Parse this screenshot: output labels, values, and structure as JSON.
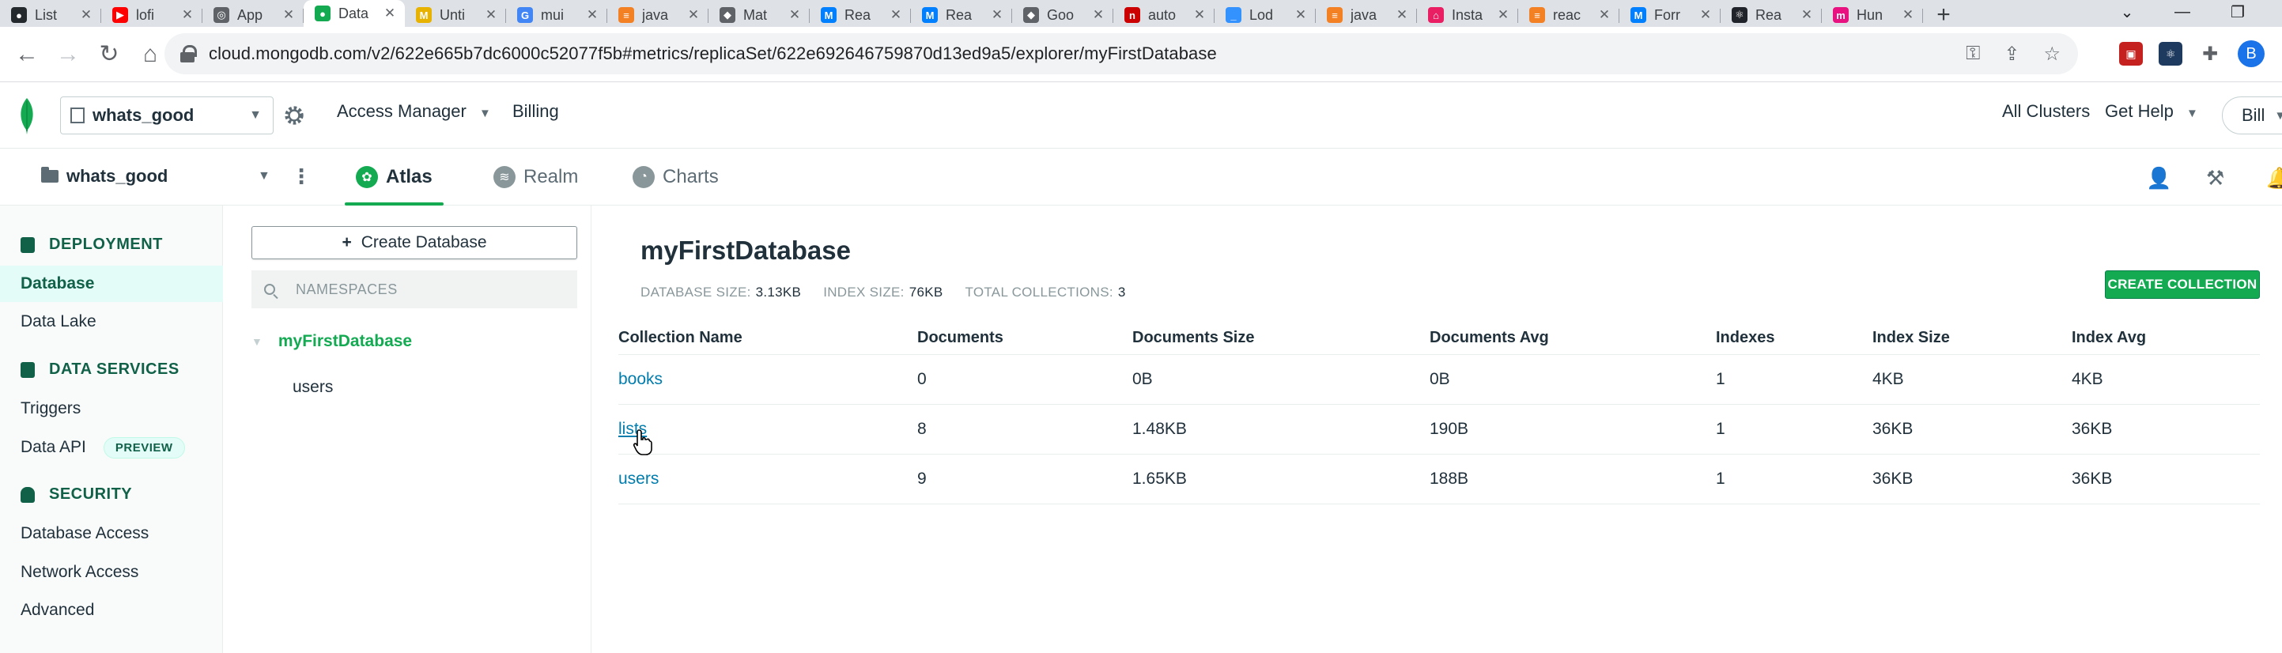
{
  "browser": {
    "tabs": [
      {
        "title": "List",
        "color": "#24292e",
        "glyph": "●"
      },
      {
        "title": "lofi",
        "color": "#ff0000",
        "glyph": "▶"
      },
      {
        "title": "App",
        "color": "#5f6368",
        "glyph": "◎"
      },
      {
        "title": "Data",
        "color": "#13aa52",
        "glyph": "●",
        "active": true
      },
      {
        "title": "Unti",
        "color": "#e8b200",
        "glyph": "M"
      },
      {
        "title": "mui",
        "color": "#4285f4",
        "glyph": "G"
      },
      {
        "title": "java",
        "color": "#f48024",
        "glyph": "≡"
      },
      {
        "title": "Mat",
        "color": "#5f6368",
        "glyph": "◆"
      },
      {
        "title": "Rea",
        "color": "#007fff",
        "glyph": "M"
      },
      {
        "title": "Rea",
        "color": "#007fff",
        "glyph": "M"
      },
      {
        "title": "Goo",
        "color": "#5f6368",
        "glyph": "◆"
      },
      {
        "title": "auto",
        "color": "#cc0000",
        "glyph": "n"
      },
      {
        "title": "Lod",
        "color": "#3492ff",
        "glyph": "_"
      },
      {
        "title": "java",
        "color": "#f48024",
        "glyph": "≡"
      },
      {
        "title": "Insta",
        "color": "#e91e63",
        "glyph": "⌂"
      },
      {
        "title": "reac",
        "color": "#f48024",
        "glyph": "≡"
      },
      {
        "title": "Forr",
        "color": "#007fff",
        "glyph": "M"
      },
      {
        "title": "Rea",
        "color": "#20232a",
        "glyph": "⚛"
      },
      {
        "title": "Hun",
        "color": "#e8117f",
        "glyph": "m"
      }
    ],
    "new_tab_label": "+",
    "url": "cloud.mongodb.com/v2/622e665b7dc6000c52077f5b#metrics/replicaSet/622e692646759870d13ed9a5/explorer/myFirstDatabase",
    "profile_initial": "B"
  },
  "topnav": {
    "org_name": "whats_good",
    "access_manager": "Access Manager",
    "billing": "Billing",
    "all_clusters": "All Clusters",
    "get_help": "Get Help",
    "user": "Bill"
  },
  "projbar": {
    "project_name": "whats_good",
    "tabs": [
      "Atlas",
      "Realm",
      "Charts"
    ]
  },
  "sidebar": {
    "deployment": "DEPLOYMENT",
    "database": "Database",
    "data_lake": "Data Lake",
    "data_services": "DATA SERVICES",
    "triggers": "Triggers",
    "data_api": "Data API",
    "preview": "PREVIEW",
    "security": "SECURITY",
    "database_access": "Database Access",
    "network_access": "Network Access",
    "advanced": "Advanced"
  },
  "namespaces": {
    "create_database": "Create Database",
    "search_placeholder": "NAMESPACES",
    "database": "myFirstDatabase",
    "collection": "users"
  },
  "main": {
    "title": "myFirstDatabase",
    "db_size_label": "DATABASE SIZE:",
    "db_size": "3.13KB",
    "index_size_label": "INDEX SIZE:",
    "index_size": "76KB",
    "total_collections_label": "TOTAL COLLECTIONS:",
    "total_collections": "3",
    "create_collection": "CREATE COLLECTION",
    "columns": [
      "Collection Name",
      "Documents",
      "Documents Size",
      "Documents Avg",
      "Indexes",
      "Index Size",
      "Index Avg"
    ],
    "rows": [
      [
        "books",
        "0",
        "0B",
        "0B",
        "1",
        "4KB",
        "4KB"
      ],
      [
        "lists",
        "8",
        "1.48KB",
        "190B",
        "1",
        "36KB",
        "36KB"
      ],
      [
        "users",
        "9",
        "1.65KB",
        "188B",
        "1",
        "36KB",
        "36KB"
      ]
    ]
  },
  "colors": {
    "mongo_green": "#13aa52",
    "mongo_dark_green": "#116149",
    "link_blue": "#007cad"
  }
}
